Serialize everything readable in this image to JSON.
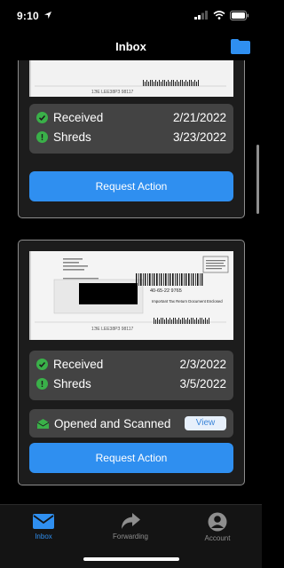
{
  "status_bar": {
    "time": "9:10"
  },
  "header": {
    "title": "Inbox",
    "folder_icon": "folder-icon"
  },
  "mail_items": [
    {
      "rows": [
        {
          "label": "Received",
          "date": "2/21/2022"
        },
        {
          "label": "Shreds",
          "date": "3/23/2022"
        }
      ],
      "action_label": "Request Action",
      "scan_text": "1ЭЕ LЕЕ38РЗ 98117"
    },
    {
      "rows": [
        {
          "label": "Received",
          "date": "2/3/2022"
        },
        {
          "label": "Shreds",
          "date": "3/5/2022"
        }
      ],
      "opened_label": "Opened and Scanned",
      "view_label": "View",
      "action_label": "Request Action",
      "scan_id": "40-65-22 9765",
      "scan_note": "Important Tax Return Document Enclosed",
      "scan_text": "1ЭЕ LЕЕ38РЗ 98117"
    }
  ],
  "tabs": [
    {
      "label": "Inbox",
      "icon": "envelope-icon",
      "active": true
    },
    {
      "label": "Forwarding",
      "icon": "forward-arrow-icon",
      "active": false
    },
    {
      "label": "Account",
      "icon": "person-icon",
      "active": false
    }
  ],
  "colors": {
    "accent": "#2F8FF0",
    "success": "#3AB049",
    "card_border": "#8D8D8D",
    "info_box": "#434343",
    "background": "#000000"
  }
}
